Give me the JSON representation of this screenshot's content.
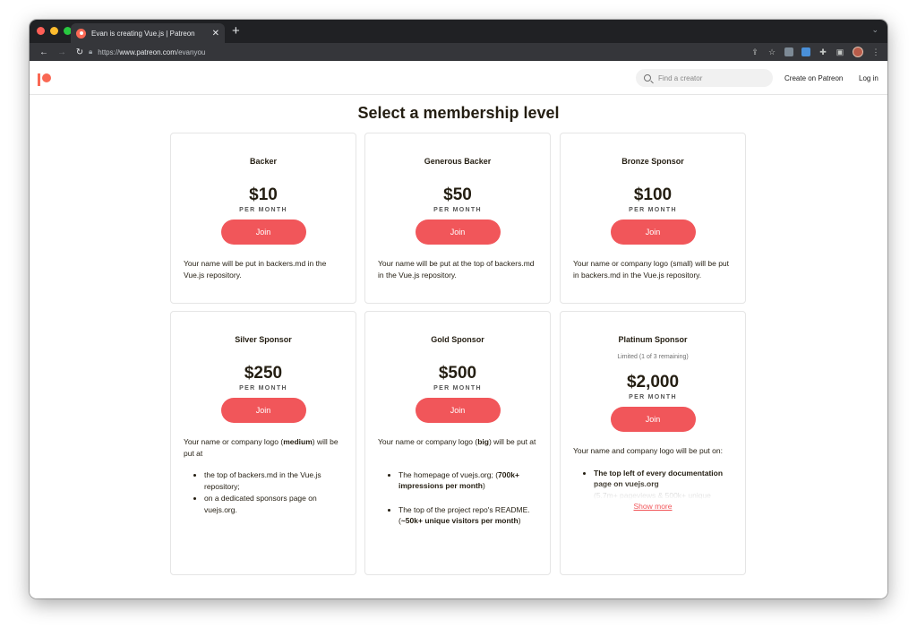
{
  "browser": {
    "tab_title": "Evan is creating Vue.js | Patreon",
    "new_tab": "+",
    "url_prefix": "https://",
    "url_domain": "www.patreon.com",
    "url_path": "/evanyou"
  },
  "header": {
    "search_placeholder": "Find a creator",
    "create_link": "Create on Patreon",
    "login_link": "Log in"
  },
  "page_title": "Select a membership level",
  "tiers": [
    {
      "name": "Backer",
      "price": "$10",
      "period": "PER MONTH",
      "join": "Join",
      "description": "Your name will be put in backers.md in the Vue.js repository."
    },
    {
      "name": "Generous Backer",
      "price": "$50",
      "period": "PER MONTH",
      "join": "Join",
      "description": "Your name will be put at the top of backers.md in the Vue.js repository."
    },
    {
      "name": "Bronze Sponsor",
      "price": "$100",
      "period": "PER MONTH",
      "join": "Join",
      "description": "Your name or company logo (small) will be put in backers.md in the Vue.js repository."
    },
    {
      "name": "Silver Sponsor",
      "price": "$250",
      "period": "PER MONTH",
      "join": "Join",
      "desc_before": "Your name or company logo (",
      "desc_bold": "medium",
      "desc_after": ") will be put at",
      "bullets": [
        "the top of backers.md in the Vue.js repository;",
        "on a dedicated sponsors page on vuejs.org."
      ]
    },
    {
      "name": "Gold Sponsor",
      "price": "$500",
      "period": "PER MONTH",
      "join": "Join",
      "desc_before": "Your name or company logo (",
      "desc_bold": "big",
      "desc_after": ") will be put at",
      "bullet1_text": "The homepage of vuejs.org; (",
      "bullet1_bold": "700k+ impressions per month",
      "bullet1_end": ")",
      "bullet2_text": "The top of the project repo's README. (",
      "bullet2_bold": "~50k+ unique visitors per month",
      "bullet2_end": ")"
    },
    {
      "name": "Platinum Sponsor",
      "limited": "Limited (1 of 3 remaining)",
      "price": "$2,000",
      "period": "PER MONTH",
      "join": "Join",
      "description": "Your name and company logo will be put on:",
      "bullet_bold": "The top left of every documentation page on vuejs.org",
      "bullet_faded": "(5.7m+ pageviews & 500k+ unique",
      "show_more": "Show more"
    }
  ],
  "colors": {
    "brand": "#f96854",
    "join_button": "#f1565a"
  }
}
